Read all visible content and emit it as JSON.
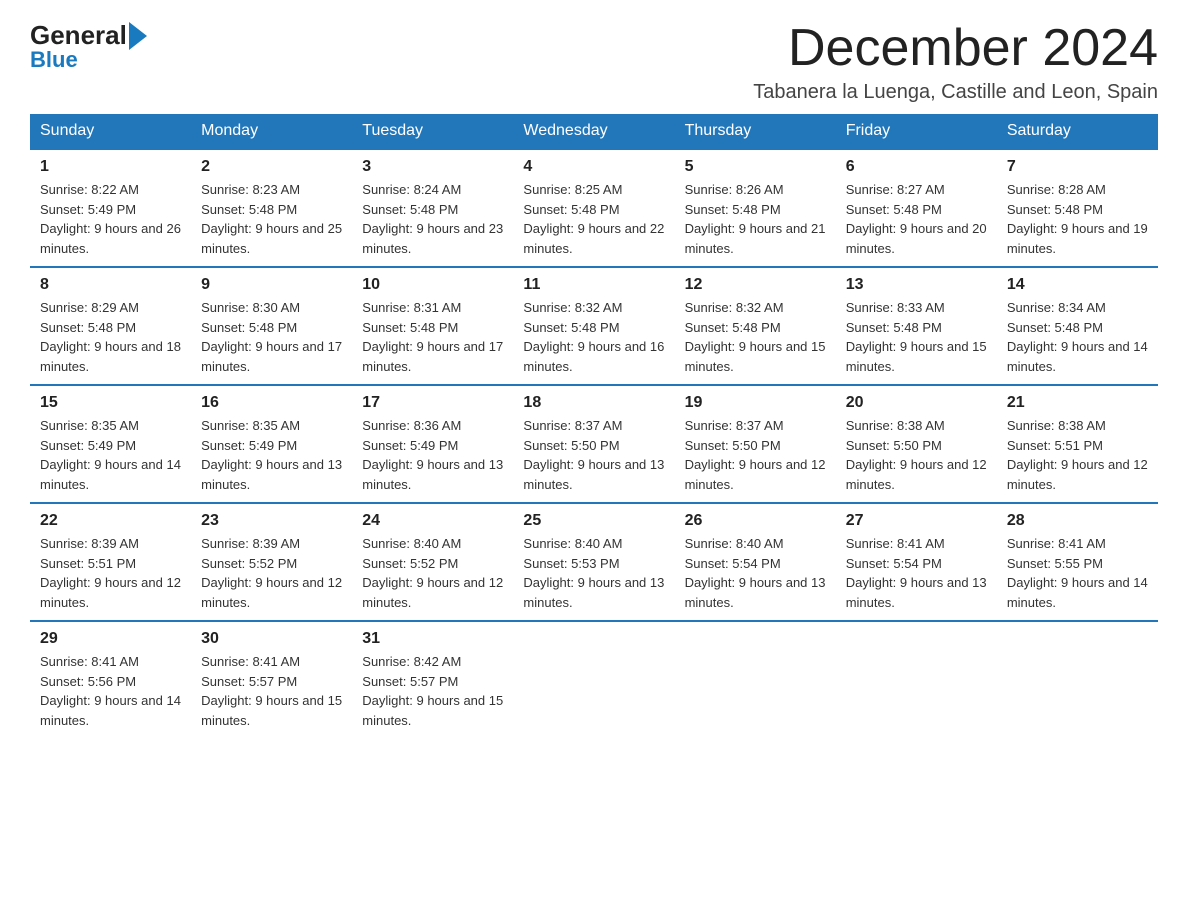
{
  "logo": {
    "general": "General",
    "arrow": "▶",
    "blue": "Blue"
  },
  "header": {
    "title": "December 2024",
    "subtitle": "Tabanera la Luenga, Castille and Leon, Spain"
  },
  "calendar": {
    "days": [
      "Sunday",
      "Monday",
      "Tuesday",
      "Wednesday",
      "Thursday",
      "Friday",
      "Saturday"
    ],
    "weeks": [
      [
        {
          "num": "1",
          "sunrise": "8:22 AM",
          "sunset": "5:49 PM",
          "daylight": "9 hours and 26 minutes."
        },
        {
          "num": "2",
          "sunrise": "8:23 AM",
          "sunset": "5:48 PM",
          "daylight": "9 hours and 25 minutes."
        },
        {
          "num": "3",
          "sunrise": "8:24 AM",
          "sunset": "5:48 PM",
          "daylight": "9 hours and 23 minutes."
        },
        {
          "num": "4",
          "sunrise": "8:25 AM",
          "sunset": "5:48 PM",
          "daylight": "9 hours and 22 minutes."
        },
        {
          "num": "5",
          "sunrise": "8:26 AM",
          "sunset": "5:48 PM",
          "daylight": "9 hours and 21 minutes."
        },
        {
          "num": "6",
          "sunrise": "8:27 AM",
          "sunset": "5:48 PM",
          "daylight": "9 hours and 20 minutes."
        },
        {
          "num": "7",
          "sunrise": "8:28 AM",
          "sunset": "5:48 PM",
          "daylight": "9 hours and 19 minutes."
        }
      ],
      [
        {
          "num": "8",
          "sunrise": "8:29 AM",
          "sunset": "5:48 PM",
          "daylight": "9 hours and 18 minutes."
        },
        {
          "num": "9",
          "sunrise": "8:30 AM",
          "sunset": "5:48 PM",
          "daylight": "9 hours and 17 minutes."
        },
        {
          "num": "10",
          "sunrise": "8:31 AM",
          "sunset": "5:48 PM",
          "daylight": "9 hours and 17 minutes."
        },
        {
          "num": "11",
          "sunrise": "8:32 AM",
          "sunset": "5:48 PM",
          "daylight": "9 hours and 16 minutes."
        },
        {
          "num": "12",
          "sunrise": "8:32 AM",
          "sunset": "5:48 PM",
          "daylight": "9 hours and 15 minutes."
        },
        {
          "num": "13",
          "sunrise": "8:33 AM",
          "sunset": "5:48 PM",
          "daylight": "9 hours and 15 minutes."
        },
        {
          "num": "14",
          "sunrise": "8:34 AM",
          "sunset": "5:48 PM",
          "daylight": "9 hours and 14 minutes."
        }
      ],
      [
        {
          "num": "15",
          "sunrise": "8:35 AM",
          "sunset": "5:49 PM",
          "daylight": "9 hours and 14 minutes."
        },
        {
          "num": "16",
          "sunrise": "8:35 AM",
          "sunset": "5:49 PM",
          "daylight": "9 hours and 13 minutes."
        },
        {
          "num": "17",
          "sunrise": "8:36 AM",
          "sunset": "5:49 PM",
          "daylight": "9 hours and 13 minutes."
        },
        {
          "num": "18",
          "sunrise": "8:37 AM",
          "sunset": "5:50 PM",
          "daylight": "9 hours and 13 minutes."
        },
        {
          "num": "19",
          "sunrise": "8:37 AM",
          "sunset": "5:50 PM",
          "daylight": "9 hours and 12 minutes."
        },
        {
          "num": "20",
          "sunrise": "8:38 AM",
          "sunset": "5:50 PM",
          "daylight": "9 hours and 12 minutes."
        },
        {
          "num": "21",
          "sunrise": "8:38 AM",
          "sunset": "5:51 PM",
          "daylight": "9 hours and 12 minutes."
        }
      ],
      [
        {
          "num": "22",
          "sunrise": "8:39 AM",
          "sunset": "5:51 PM",
          "daylight": "9 hours and 12 minutes."
        },
        {
          "num": "23",
          "sunrise": "8:39 AM",
          "sunset": "5:52 PM",
          "daylight": "9 hours and 12 minutes."
        },
        {
          "num": "24",
          "sunrise": "8:40 AM",
          "sunset": "5:52 PM",
          "daylight": "9 hours and 12 minutes."
        },
        {
          "num": "25",
          "sunrise": "8:40 AM",
          "sunset": "5:53 PM",
          "daylight": "9 hours and 13 minutes."
        },
        {
          "num": "26",
          "sunrise": "8:40 AM",
          "sunset": "5:54 PM",
          "daylight": "9 hours and 13 minutes."
        },
        {
          "num": "27",
          "sunrise": "8:41 AM",
          "sunset": "5:54 PM",
          "daylight": "9 hours and 13 minutes."
        },
        {
          "num": "28",
          "sunrise": "8:41 AM",
          "sunset": "5:55 PM",
          "daylight": "9 hours and 14 minutes."
        }
      ],
      [
        {
          "num": "29",
          "sunrise": "8:41 AM",
          "sunset": "5:56 PM",
          "daylight": "9 hours and 14 minutes."
        },
        {
          "num": "30",
          "sunrise": "8:41 AM",
          "sunset": "5:57 PM",
          "daylight": "9 hours and 15 minutes."
        },
        {
          "num": "31",
          "sunrise": "8:42 AM",
          "sunset": "5:57 PM",
          "daylight": "9 hours and 15 minutes."
        },
        null,
        null,
        null,
        null
      ]
    ]
  }
}
